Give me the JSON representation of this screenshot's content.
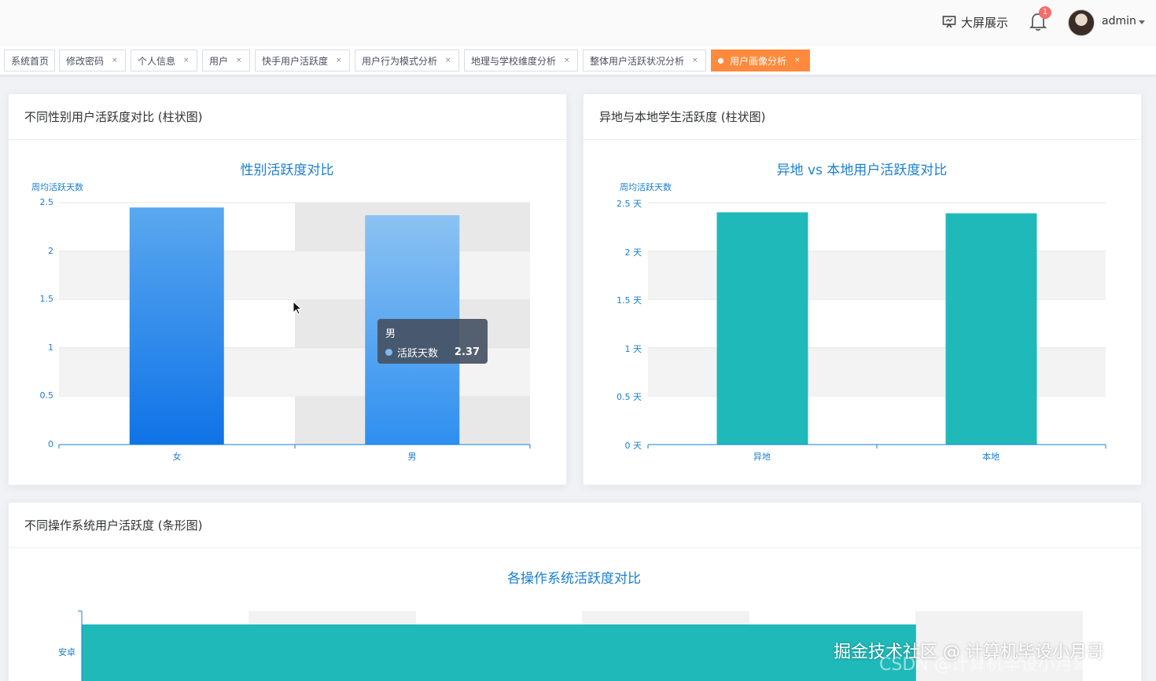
{
  "header": {
    "big_screen_label": "大屏展示",
    "notification_count": "1",
    "user_name": "admin"
  },
  "tags": [
    {
      "label": "系统首页",
      "closable": false,
      "active": false
    },
    {
      "label": "修改密码",
      "closable": true,
      "active": false
    },
    {
      "label": "个人信息",
      "closable": true,
      "active": false
    },
    {
      "label": "用户",
      "closable": true,
      "active": false
    },
    {
      "label": "快手用户活跃度",
      "closable": true,
      "active": false
    },
    {
      "label": "用户行为模式分析",
      "closable": true,
      "active": false
    },
    {
      "label": "地理与学校维度分析",
      "closable": true,
      "active": false
    },
    {
      "label": "整体用户活跃状况分析",
      "closable": true,
      "active": false
    },
    {
      "label": "用户画像分析",
      "closable": true,
      "active": true
    }
  ],
  "tag_close_glyph": "×",
  "cards": {
    "gender": {
      "header": "不同性别用户活跃度对比 (柱状图)"
    },
    "location": {
      "header": "异地与本地学生活跃度 (柱状图)"
    },
    "os": {
      "header": "不同操作系统用户活跃度 (条形图)"
    }
  },
  "tooltip": {
    "title": "男",
    "series_name": "活跃天数",
    "value": "2.37"
  },
  "watermark": {
    "line1": "掘金技术社区 @ 计算机毕设小月哥",
    "line2": "CSDN @计算机毕设小月哥"
  },
  "colors": {
    "accent": "#1a7fd1",
    "teal": "#20b9b9",
    "active_tag": "#ff8a3d",
    "blue_top": "#5aa8ef",
    "blue_bottom": "#0f73e6"
  },
  "chart_data": [
    {
      "type": "bar",
      "title": "性别活跃度对比",
      "ylabel": "周均活跃天数",
      "categories": [
        "女",
        "男"
      ],
      "values": [
        2.45,
        2.37
      ],
      "ylim": [
        0,
        2.5
      ],
      "yticks": [
        "0",
        "0.5",
        "1",
        "1.5",
        "2",
        "2.5"
      ],
      "grid": true
    },
    {
      "type": "bar",
      "title": "异地 vs 本地用户活跃度对比",
      "ylabel": "周均活跃天数",
      "categories": [
        "异地",
        "本地"
      ],
      "values": [
        2.4,
        2.39
      ],
      "ylim": [
        0,
        2.5
      ],
      "yticks": [
        "0 天",
        "0.5 天",
        "1 天",
        "1.5 天",
        "2 天",
        "2.5 天"
      ],
      "grid": true
    },
    {
      "type": "bar",
      "orientation": "horizontal",
      "title": "各操作系统活跃度对比",
      "categories": [
        "安卓"
      ],
      "values": [
        2.5
      ],
      "xlim": [
        0,
        3
      ]
    }
  ]
}
